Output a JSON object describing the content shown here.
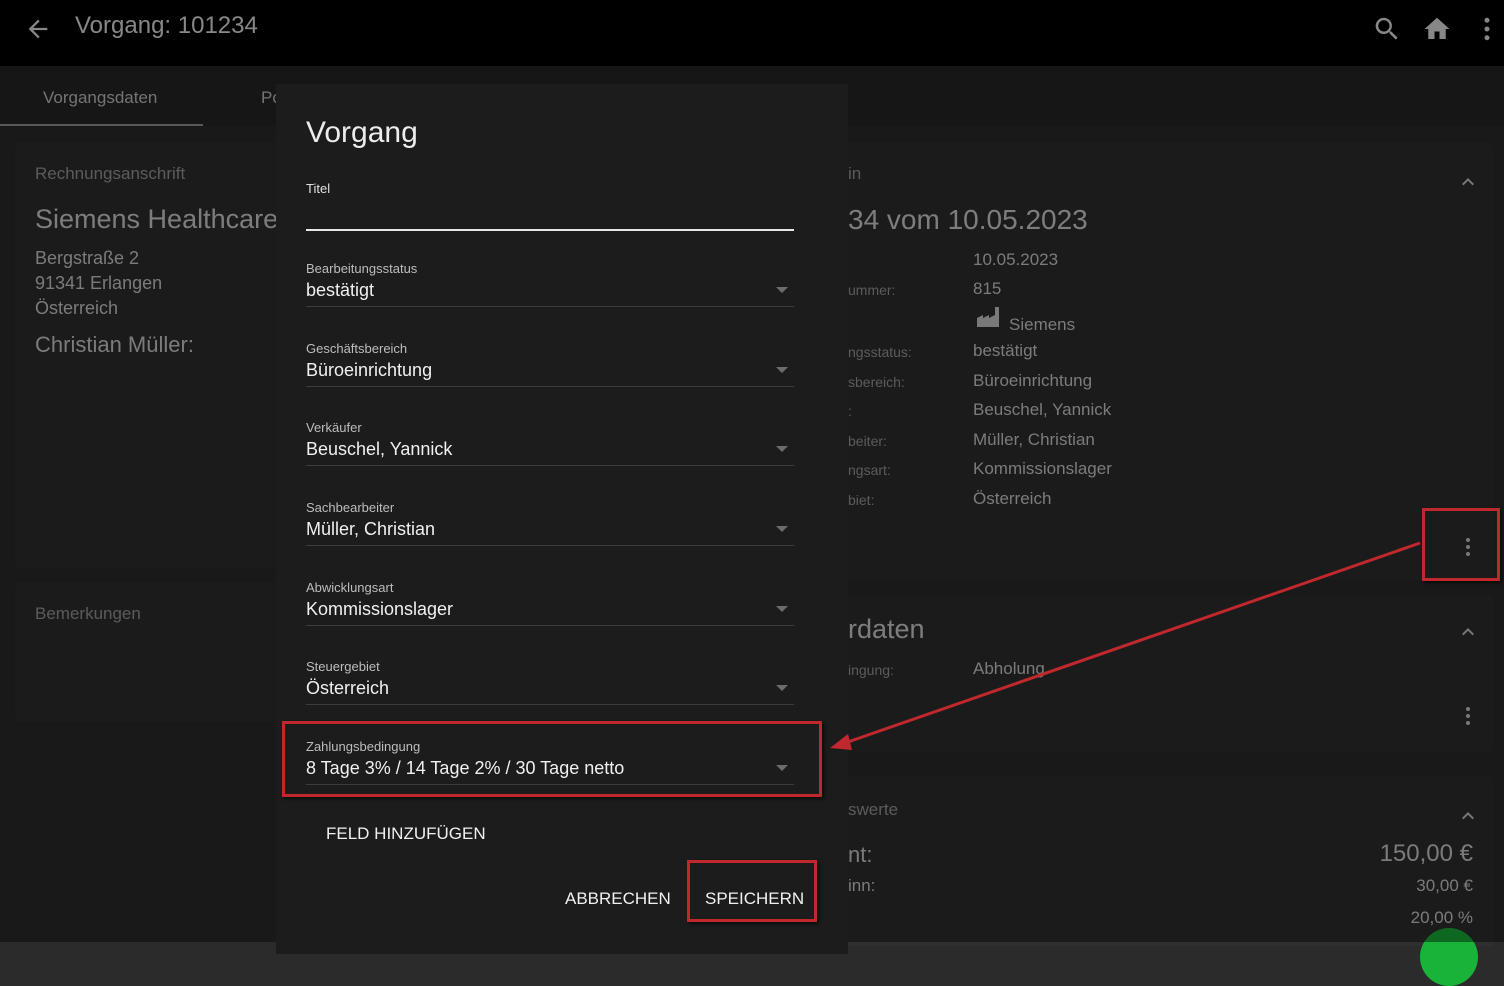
{
  "header": {
    "title": "Vorgang: 101234",
    "icons": [
      "arrow-left-icon",
      "search-icon",
      "home-icon",
      "more-vertical-icon"
    ]
  },
  "tabs": [
    {
      "label": "Vorgangsdaten"
    },
    {
      "label": "Po"
    }
  ],
  "left": {
    "address_card": {
      "heading": "Rechnungsanschrift",
      "company": "Siemens Healthcare",
      "street": "Bergstraße 2",
      "city": "91341 Erlangen",
      "country": "Österreich",
      "contact": "Christian Müller:"
    },
    "remarks_card": {
      "heading": "Bemerkungen"
    }
  },
  "right": {
    "general_card": {
      "heading": "in",
      "title": "34 vom 10.05.2023",
      "rows": [
        {
          "label": "",
          "value": "10.05.2023"
        },
        {
          "label": "ummer:",
          "value": "815"
        },
        {
          "label": "",
          "value": "Siemens"
        },
        {
          "label": "ngsstatus:",
          "value": "bestätigt"
        },
        {
          "label": "sbereich:",
          "value": "Büroeinrichtung"
        },
        {
          "label": ":",
          "value": "Beuschel, Yannick"
        },
        {
          "label": "beiter:",
          "value": "Müller, Christian"
        },
        {
          "label": "ngsart:",
          "value": "Kommissionslager"
        },
        {
          "label": "biet:",
          "value": "Österreich"
        }
      ]
    },
    "order_card": {
      "heading": "rdaten",
      "rows": [
        {
          "label": "ingung:",
          "value": "Abholung"
        }
      ]
    },
    "values_card": {
      "heading": "swerte",
      "rows": [
        {
          "label": "nt:",
          "value": "150,00 €"
        },
        {
          "label": "inn:",
          "value": "30,00 €"
        },
        {
          "label": "",
          "value": "20,00 %"
        }
      ]
    }
  },
  "dialog": {
    "title": "Vorgang",
    "fields": [
      {
        "label": "Titel",
        "value": ""
      },
      {
        "label": "Bearbeitungsstatus",
        "value": "bestätigt"
      },
      {
        "label": "Geschäftsbereich",
        "value": "Büroeinrichtung"
      },
      {
        "label": "Verkäufer",
        "value": "Beuschel, Yannick"
      },
      {
        "label": "Sachbearbeiter",
        "value": "Müller, Christian"
      },
      {
        "label": "Abwicklungsart",
        "value": "Kommissionslager"
      },
      {
        "label": "Steuergebiet",
        "value": "Österreich"
      },
      {
        "label": "Zahlungsbedingung",
        "value": "8 Tage 3% / 14 Tage 2% / 30 Tage netto"
      }
    ],
    "add_field_label": "FELD HINZUFÜGEN",
    "cancel_label": "ABBRECHEN",
    "save_label": "SPEICHERN"
  },
  "colors": {
    "highlight": "#c0282d",
    "success": "#19b33a"
  }
}
